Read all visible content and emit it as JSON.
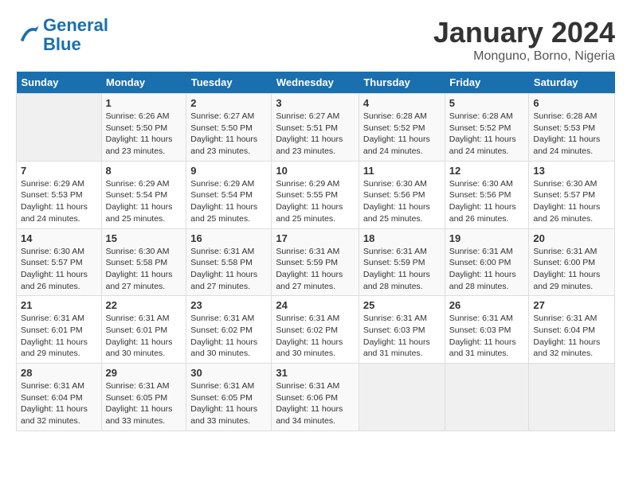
{
  "logo": {
    "line1": "General",
    "line2": "Blue"
  },
  "title": "January 2024",
  "subtitle": "Monguno, Borno, Nigeria",
  "days_of_week": [
    "Sunday",
    "Monday",
    "Tuesday",
    "Wednesday",
    "Thursday",
    "Friday",
    "Saturday"
  ],
  "weeks": [
    [
      {
        "day": "",
        "info": ""
      },
      {
        "day": "1",
        "info": "Sunrise: 6:26 AM\nSunset: 5:50 PM\nDaylight: 11 hours\nand 23 minutes."
      },
      {
        "day": "2",
        "info": "Sunrise: 6:27 AM\nSunset: 5:50 PM\nDaylight: 11 hours\nand 23 minutes."
      },
      {
        "day": "3",
        "info": "Sunrise: 6:27 AM\nSunset: 5:51 PM\nDaylight: 11 hours\nand 23 minutes."
      },
      {
        "day": "4",
        "info": "Sunrise: 6:28 AM\nSunset: 5:52 PM\nDaylight: 11 hours\nand 24 minutes."
      },
      {
        "day": "5",
        "info": "Sunrise: 6:28 AM\nSunset: 5:52 PM\nDaylight: 11 hours\nand 24 minutes."
      },
      {
        "day": "6",
        "info": "Sunrise: 6:28 AM\nSunset: 5:53 PM\nDaylight: 11 hours\nand 24 minutes."
      }
    ],
    [
      {
        "day": "7",
        "info": "Sunrise: 6:29 AM\nSunset: 5:53 PM\nDaylight: 11 hours\nand 24 minutes."
      },
      {
        "day": "8",
        "info": "Sunrise: 6:29 AM\nSunset: 5:54 PM\nDaylight: 11 hours\nand 25 minutes."
      },
      {
        "day": "9",
        "info": "Sunrise: 6:29 AM\nSunset: 5:54 PM\nDaylight: 11 hours\nand 25 minutes."
      },
      {
        "day": "10",
        "info": "Sunrise: 6:29 AM\nSunset: 5:55 PM\nDaylight: 11 hours\nand 25 minutes."
      },
      {
        "day": "11",
        "info": "Sunrise: 6:30 AM\nSunset: 5:56 PM\nDaylight: 11 hours\nand 25 minutes."
      },
      {
        "day": "12",
        "info": "Sunrise: 6:30 AM\nSunset: 5:56 PM\nDaylight: 11 hours\nand 26 minutes."
      },
      {
        "day": "13",
        "info": "Sunrise: 6:30 AM\nSunset: 5:57 PM\nDaylight: 11 hours\nand 26 minutes."
      }
    ],
    [
      {
        "day": "14",
        "info": "Sunrise: 6:30 AM\nSunset: 5:57 PM\nDaylight: 11 hours\nand 26 minutes."
      },
      {
        "day": "15",
        "info": "Sunrise: 6:30 AM\nSunset: 5:58 PM\nDaylight: 11 hours\nand 27 minutes."
      },
      {
        "day": "16",
        "info": "Sunrise: 6:31 AM\nSunset: 5:58 PM\nDaylight: 11 hours\nand 27 minutes."
      },
      {
        "day": "17",
        "info": "Sunrise: 6:31 AM\nSunset: 5:59 PM\nDaylight: 11 hours\nand 27 minutes."
      },
      {
        "day": "18",
        "info": "Sunrise: 6:31 AM\nSunset: 5:59 PM\nDaylight: 11 hours\nand 28 minutes."
      },
      {
        "day": "19",
        "info": "Sunrise: 6:31 AM\nSunset: 6:00 PM\nDaylight: 11 hours\nand 28 minutes."
      },
      {
        "day": "20",
        "info": "Sunrise: 6:31 AM\nSunset: 6:00 PM\nDaylight: 11 hours\nand 29 minutes."
      }
    ],
    [
      {
        "day": "21",
        "info": "Sunrise: 6:31 AM\nSunset: 6:01 PM\nDaylight: 11 hours\nand 29 minutes."
      },
      {
        "day": "22",
        "info": "Sunrise: 6:31 AM\nSunset: 6:01 PM\nDaylight: 11 hours\nand 30 minutes."
      },
      {
        "day": "23",
        "info": "Sunrise: 6:31 AM\nSunset: 6:02 PM\nDaylight: 11 hours\nand 30 minutes."
      },
      {
        "day": "24",
        "info": "Sunrise: 6:31 AM\nSunset: 6:02 PM\nDaylight: 11 hours\nand 30 minutes."
      },
      {
        "day": "25",
        "info": "Sunrise: 6:31 AM\nSunset: 6:03 PM\nDaylight: 11 hours\nand 31 minutes."
      },
      {
        "day": "26",
        "info": "Sunrise: 6:31 AM\nSunset: 6:03 PM\nDaylight: 11 hours\nand 31 minutes."
      },
      {
        "day": "27",
        "info": "Sunrise: 6:31 AM\nSunset: 6:04 PM\nDaylight: 11 hours\nand 32 minutes."
      }
    ],
    [
      {
        "day": "28",
        "info": "Sunrise: 6:31 AM\nSunset: 6:04 PM\nDaylight: 11 hours\nand 32 minutes."
      },
      {
        "day": "29",
        "info": "Sunrise: 6:31 AM\nSunset: 6:05 PM\nDaylight: 11 hours\nand 33 minutes."
      },
      {
        "day": "30",
        "info": "Sunrise: 6:31 AM\nSunset: 6:05 PM\nDaylight: 11 hours\nand 33 minutes."
      },
      {
        "day": "31",
        "info": "Sunrise: 6:31 AM\nSunset: 6:06 PM\nDaylight: 11 hours\nand 34 minutes."
      },
      {
        "day": "",
        "info": ""
      },
      {
        "day": "",
        "info": ""
      },
      {
        "day": "",
        "info": ""
      }
    ]
  ]
}
